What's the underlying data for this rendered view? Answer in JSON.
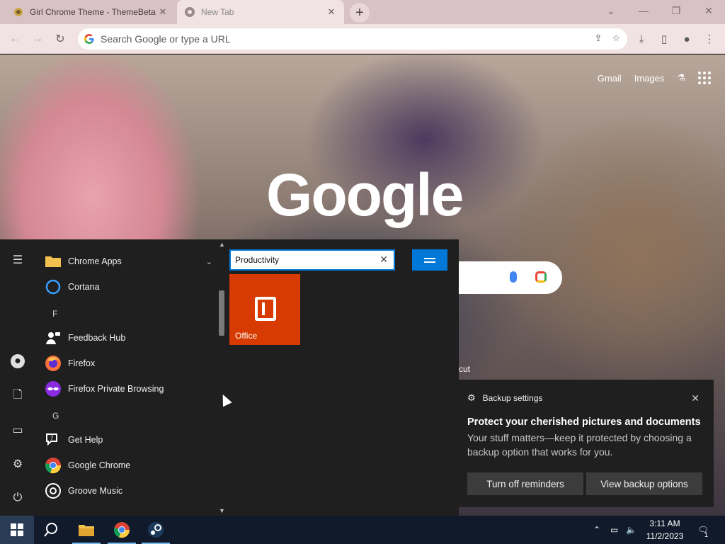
{
  "browser": {
    "tabs": [
      {
        "title": "Girl Chrome Theme - ThemeBeta",
        "favicon": "themebeta-favicon",
        "active": false
      },
      {
        "title": "New Tab",
        "favicon": "chrome-favicon",
        "active": true
      }
    ],
    "omnibox": {
      "placeholder": "Search Google or type a URL",
      "value": ""
    },
    "toolbar_icons": [
      "share-icon",
      "star-icon",
      "download-icon",
      "side-panel-icon",
      "profile-icon",
      "menu-icon"
    ]
  },
  "newtab": {
    "links": {
      "gmail": "Gmail",
      "images": "Images"
    },
    "logo": "Google",
    "shortcut_fragment": "cut"
  },
  "start_menu": {
    "rail_icons": [
      "hamburger-icon",
      "user-icon",
      "documents-icon",
      "pictures-icon",
      "settings-icon",
      "power-icon"
    ],
    "apps": [
      {
        "label": "Chrome Apps",
        "icon": "folder-icon",
        "expandable": true
      },
      {
        "label": "Cortana",
        "icon": "cortana-icon"
      },
      {
        "letter": "F"
      },
      {
        "label": "Feedback Hub",
        "icon": "feedback-hub-icon"
      },
      {
        "label": "Firefox",
        "icon": "firefox-icon"
      },
      {
        "label": "Firefox Private Browsing",
        "icon": "firefox-private-icon"
      },
      {
        "letter": "G"
      },
      {
        "label": "Get Help",
        "icon": "get-help-icon"
      },
      {
        "label": "Google Chrome",
        "icon": "chrome-icon"
      },
      {
        "label": "Groove Music",
        "icon": "groove-music-icon"
      }
    ],
    "group_name": {
      "value": "Productivity"
    },
    "tiles": [
      {
        "label": "Office",
        "color": "#d83b01",
        "icon": "office-icon"
      }
    ]
  },
  "toast": {
    "header": "Backup settings",
    "title": "Protect your cherished pictures and documents",
    "body": "Your stuff matters—keep it protected by choosing a backup option that works for you.",
    "buttons": {
      "left": "Turn off reminders",
      "right": "View backup options"
    }
  },
  "taskbar": {
    "pinned": [
      "start-icon",
      "search-icon",
      "file-explorer-icon",
      "chrome-icon",
      "steam-icon"
    ],
    "clock": {
      "time": "3:11 AM",
      "date": "11/2/2023"
    },
    "notifications": "1"
  },
  "colors": {
    "accent": "#0078d7",
    "office_tile": "#d83b01",
    "tabstrip": "#d9c2c6"
  }
}
